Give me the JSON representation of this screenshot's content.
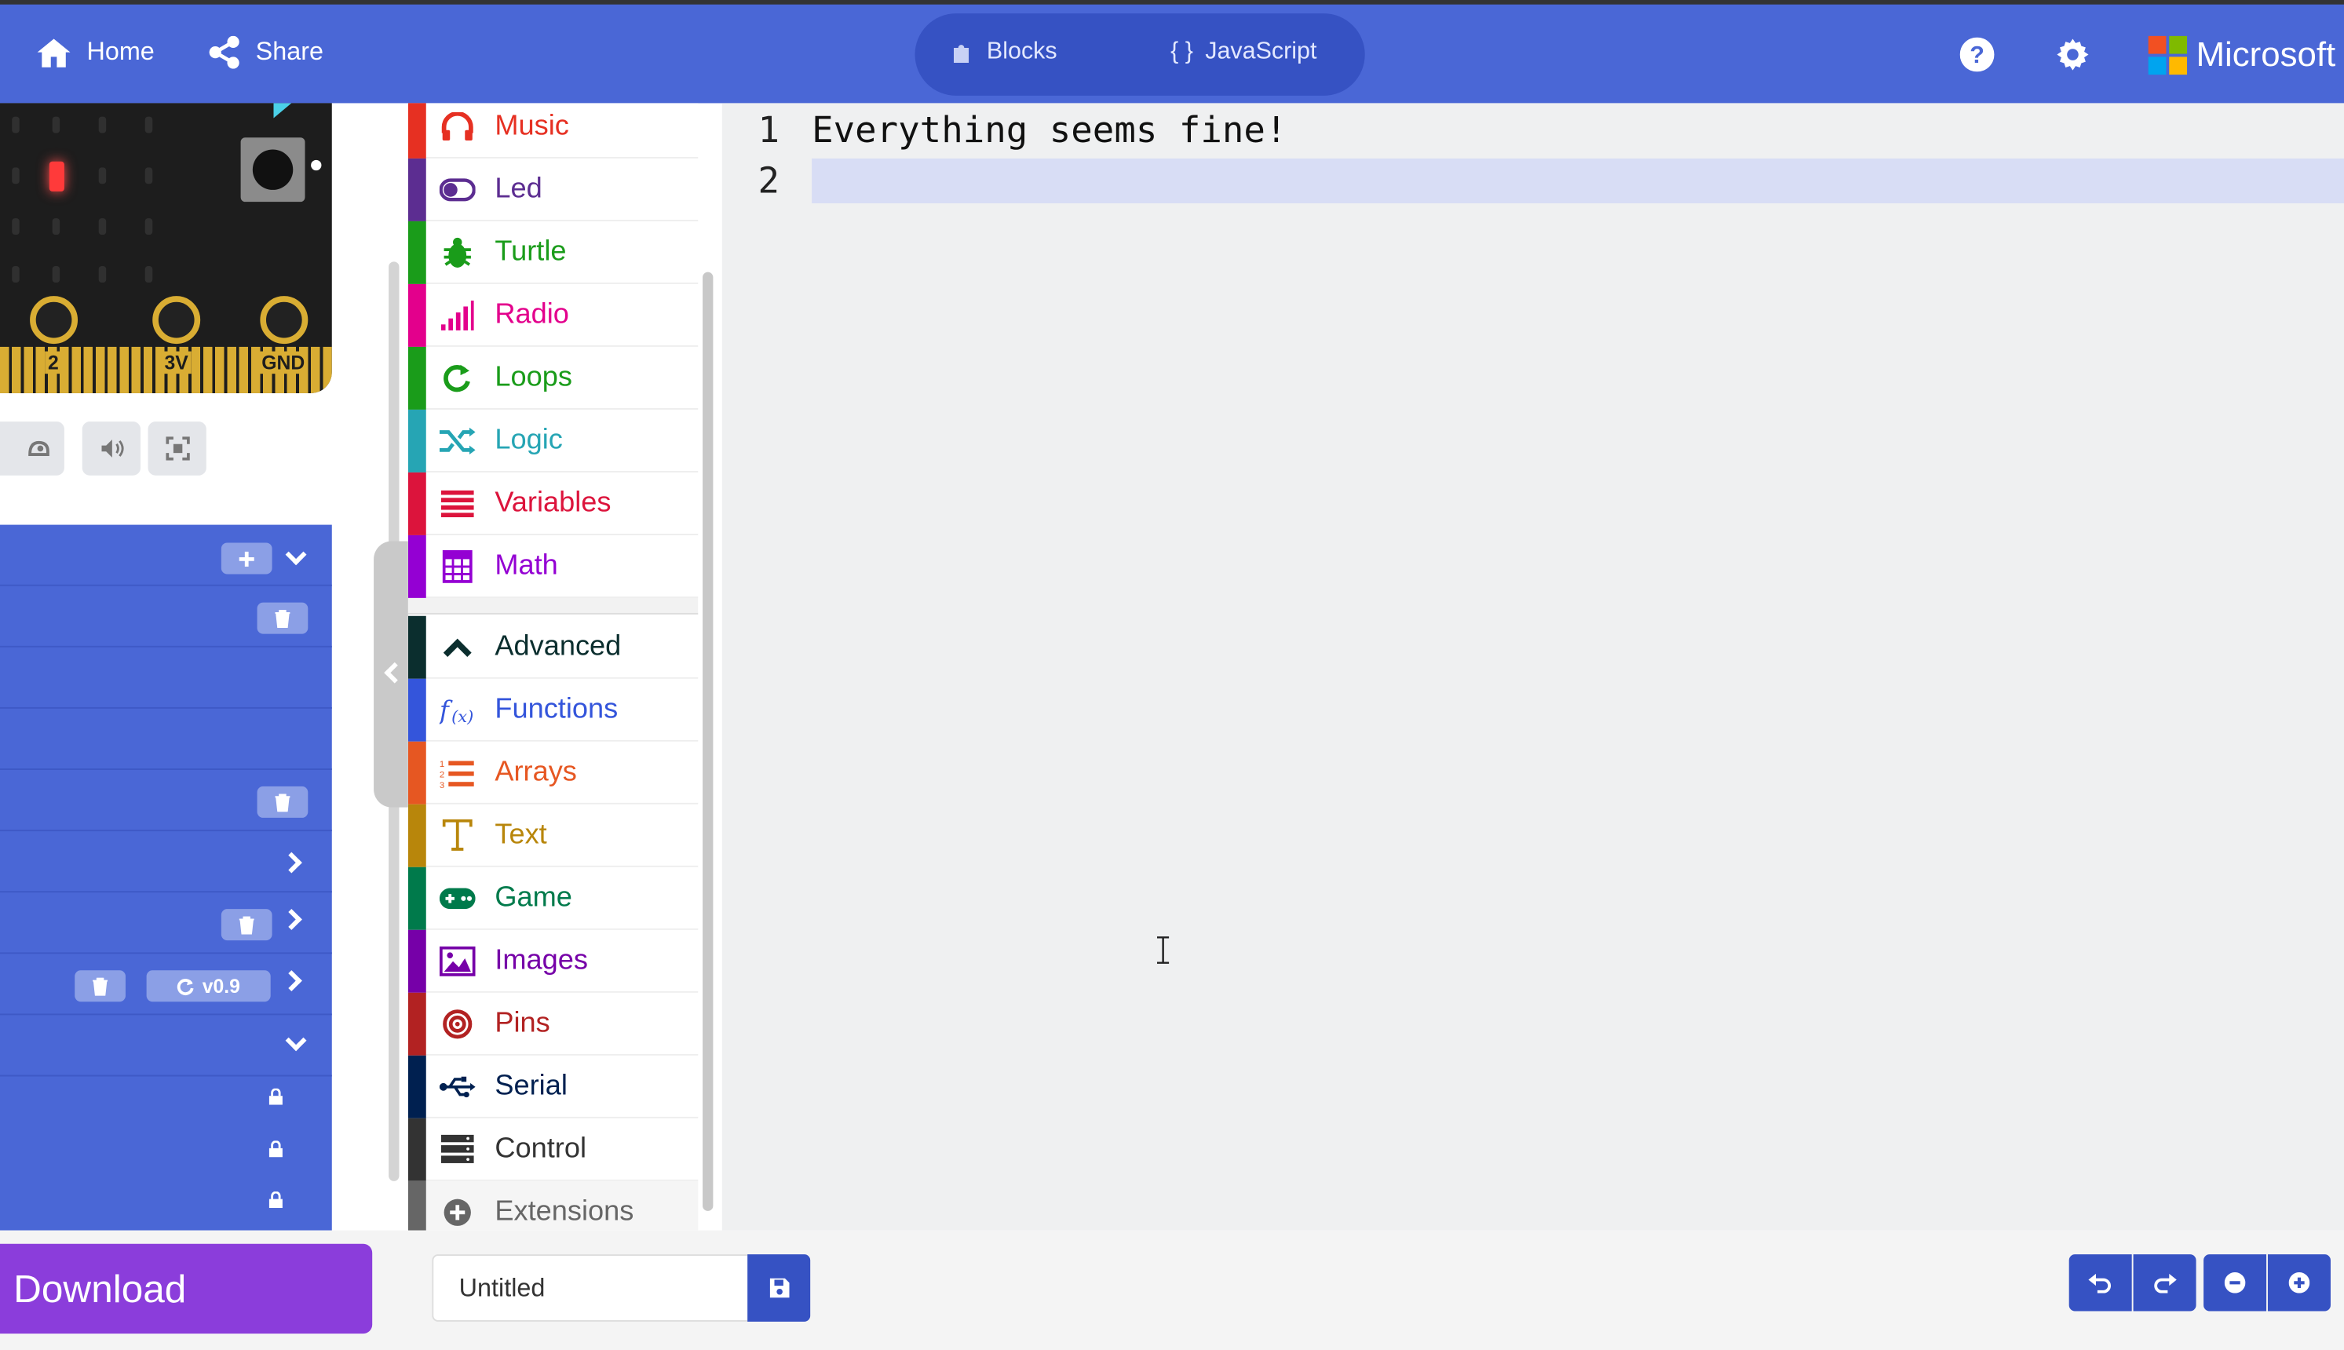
{
  "header": {
    "home_label": "Home",
    "share_label": "Share",
    "blocks_label": "Blocks",
    "javascript_label": "JavaScript",
    "javascript_glyph": "{ }",
    "brand_label": "Microsoft",
    "help_icon": "help-icon",
    "settings_icon": "gear-icon"
  },
  "simulator": {
    "pins": [
      "2",
      "3V",
      "GND"
    ],
    "controls": [
      "slow-motion-icon",
      "sound-icon",
      "fullscreen-icon"
    ]
  },
  "explorer": {
    "version_label": "v0.9"
  },
  "toolbox": {
    "items": [
      {
        "label": "Music",
        "color": "#e63022",
        "icon": "headphones-icon"
      },
      {
        "label": "Led",
        "color": "#5c2d91",
        "icon": "toggle-icon"
      },
      {
        "label": "Turtle",
        "color": "#1a9c1a",
        "icon": "bug-icon"
      },
      {
        "label": "Radio",
        "color": "#e3008c",
        "icon": "signal-icon"
      },
      {
        "label": "Loops",
        "color": "#1a9c1a",
        "icon": "refresh-icon"
      },
      {
        "label": "Logic",
        "color": "#26a5b4",
        "icon": "shuffle-icon"
      },
      {
        "label": "Variables",
        "color": "#dc143c",
        "icon": "list-icon"
      },
      {
        "label": "Math",
        "color": "#9400d3",
        "icon": "calculator-icon"
      },
      {
        "label": "Advanced",
        "color": "#0b2e2e",
        "icon": "chevron-up-icon"
      },
      {
        "label": "Functions",
        "color": "#3455db",
        "icon": "function-icon"
      },
      {
        "label": "Arrays",
        "color": "#e65722",
        "icon": "ordered-list-icon"
      },
      {
        "label": "Text",
        "color": "#b8860b",
        "icon": "text-icon"
      },
      {
        "label": "Game",
        "color": "#007a4b",
        "icon": "gamepad-icon"
      },
      {
        "label": "Images",
        "color": "#7600a8",
        "icon": "image-icon"
      },
      {
        "label": "Pins",
        "color": "#b22222",
        "icon": "target-icon"
      },
      {
        "label": "Serial",
        "color": "#002050",
        "icon": "usb-icon"
      },
      {
        "label": "Control",
        "color": "#333333",
        "icon": "server-icon"
      },
      {
        "label": "Extensions",
        "color": "#666666",
        "icon": "plus-circle-icon"
      }
    ]
  },
  "editor": {
    "line_numbers": [
      "1",
      "2"
    ],
    "lines": [
      "Everything seems fine!",
      ""
    ]
  },
  "footer": {
    "download_label": "Download",
    "project_name": "Untitled",
    "save_icon": "save-icon",
    "undo_icon": "undo-icon",
    "redo_icon": "redo-icon",
    "zoom_out_icon": "zoom-out-icon",
    "zoom_in_icon": "zoom-in-icon"
  }
}
